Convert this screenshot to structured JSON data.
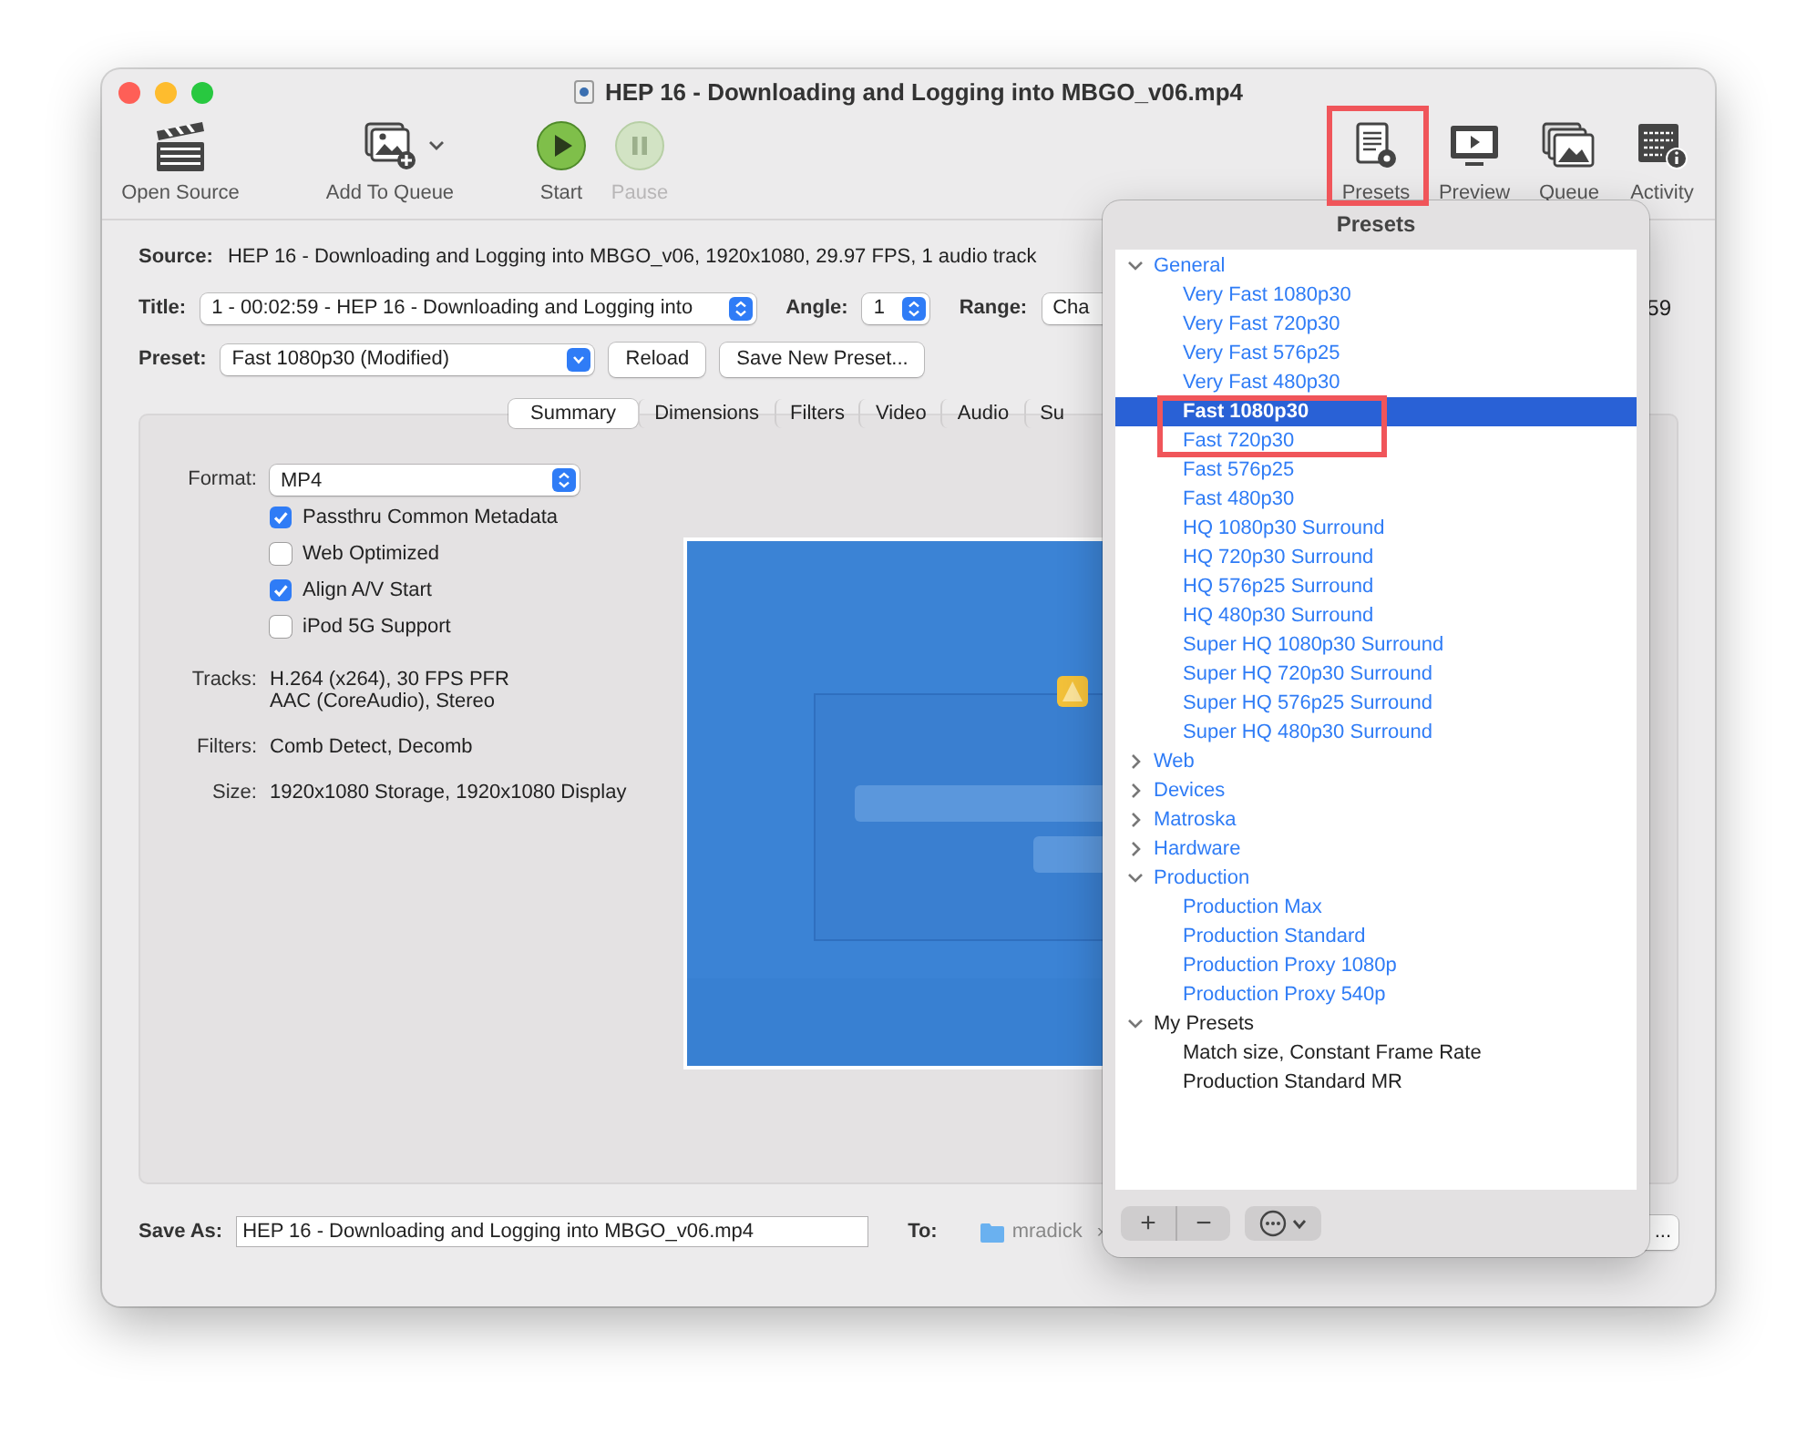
{
  "window": {
    "title": "HEP 16 - Downloading and Logging into MBGO_v06.mp4"
  },
  "toolbar": {
    "left": [
      {
        "label": "Open Source",
        "disabled": false
      },
      {
        "label": "Add To Queue",
        "disabled": false
      },
      {
        "label": "Start",
        "disabled": false
      },
      {
        "label": "Pause",
        "disabled": true
      }
    ],
    "right": [
      {
        "label": "Presets",
        "disabled": false
      },
      {
        "label": "Preview",
        "disabled": false
      },
      {
        "label": "Queue",
        "disabled": false
      },
      {
        "label": "Activity",
        "disabled": false
      }
    ]
  },
  "source": {
    "label": "Source:",
    "value": "HEP 16 - Downloading and Logging into MBGO_v06, 1920x1080, 29.97 FPS, 1 audio track"
  },
  "title_row": {
    "label": "Title:",
    "value": "1 - 00:02:59 - HEP 16 - Downloading and Logging into",
    "angle_label": "Angle:",
    "angle_value": "1",
    "range_label": "Range:",
    "range_value": "Cha",
    "column_5": "59"
  },
  "preset_row": {
    "label": "Preset:",
    "value": "Fast 1080p30 (Modified)",
    "buttons": [
      "Reload",
      "Save New Preset..."
    ]
  },
  "tabs": [
    {
      "label": "Summary",
      "selected": true
    },
    {
      "label": "Dimensions",
      "selected": false
    },
    {
      "label": "Filters",
      "selected": false
    },
    {
      "label": "Video",
      "selected": false
    },
    {
      "label": "Audio",
      "selected": false
    },
    {
      "label": "Su",
      "selected": false
    }
  ],
  "summary": {
    "format_label": "Format:",
    "format_value": "MP4",
    "options": [
      {
        "label": "Passthru Common Metadata",
        "checked": true
      },
      {
        "label": "Web Optimized",
        "checked": false
      },
      {
        "label": "Align A/V Start",
        "checked": true
      },
      {
        "label": "iPod 5G Support",
        "checked": false
      }
    ],
    "details": [
      {
        "label": "Tracks:",
        "lines": [
          "H.264 (x264), 30 FPS PFR",
          "AAC (CoreAudio), Stereo"
        ]
      },
      {
        "label": "Filters:",
        "lines": [
          "Comb Detect, Decomb"
        ]
      },
      {
        "label": "Size:",
        "lines": [
          "1920x1080 Storage, 1920x1080 Display"
        ]
      }
    ]
  },
  "save": {
    "label": "Save As:",
    "value": "HEP 16 - Downloading and Logging into MBGO_v06.mp4",
    "to_label": "To:",
    "folder": "mradick",
    "separator": "›",
    "button": "..."
  },
  "presets": {
    "title": "Presets",
    "tree": [
      {
        "label": "General",
        "kind": "builtin",
        "expanded": true,
        "children": [
          {
            "label": "Very Fast 1080p30",
            "kind": "builtin",
            "selected": false
          },
          {
            "label": "Very Fast 720p30",
            "kind": "builtin",
            "selected": false
          },
          {
            "label": "Very Fast 576p25",
            "kind": "builtin",
            "selected": false
          },
          {
            "label": "Very Fast 480p30",
            "kind": "builtin",
            "selected": false
          },
          {
            "label": "Fast 1080p30",
            "kind": "builtin",
            "selected": true
          },
          {
            "label": "Fast 720p30",
            "kind": "builtin",
            "selected": false
          },
          {
            "label": "Fast 576p25",
            "kind": "builtin",
            "selected": false
          },
          {
            "label": "Fast 480p30",
            "kind": "builtin",
            "selected": false
          },
          {
            "label": "HQ 1080p30 Surround",
            "kind": "builtin",
            "selected": false
          },
          {
            "label": "HQ 720p30 Surround",
            "kind": "builtin",
            "selected": false
          },
          {
            "label": "HQ 576p25 Surround",
            "kind": "builtin",
            "selected": false
          },
          {
            "label": "HQ 480p30 Surround",
            "kind": "builtin",
            "selected": false
          },
          {
            "label": "Super HQ 1080p30 Surround",
            "kind": "builtin",
            "selected": false
          },
          {
            "label": "Super HQ 720p30 Surround",
            "kind": "builtin",
            "selected": false
          },
          {
            "label": "Super HQ 576p25 Surround",
            "kind": "builtin",
            "selected": false
          },
          {
            "label": "Super HQ 480p30 Surround",
            "kind": "builtin",
            "selected": false
          }
        ]
      },
      {
        "label": "Web",
        "kind": "builtin",
        "expanded": false
      },
      {
        "label": "Devices",
        "kind": "builtin",
        "expanded": false
      },
      {
        "label": "Matroska",
        "kind": "builtin",
        "expanded": false
      },
      {
        "label": "Hardware",
        "kind": "builtin",
        "expanded": false
      },
      {
        "label": "Production",
        "kind": "builtin",
        "expanded": true,
        "children": [
          {
            "label": "Production Max",
            "kind": "builtin",
            "selected": false
          },
          {
            "label": "Production Standard",
            "kind": "builtin",
            "selected": false
          },
          {
            "label": "Production Proxy 1080p",
            "kind": "builtin",
            "selected": false
          },
          {
            "label": "Production Proxy 540p",
            "kind": "builtin",
            "selected": false
          }
        ]
      },
      {
        "label": "My Presets",
        "kind": "custom",
        "expanded": true,
        "children": [
          {
            "label": "Match size, Constant Frame Rate",
            "kind": "custom",
            "selected": false
          },
          {
            "label": "Production Standard MR",
            "kind": "custom",
            "selected": false
          }
        ]
      }
    ],
    "footer_buttons": [
      "+",
      "−"
    ]
  }
}
